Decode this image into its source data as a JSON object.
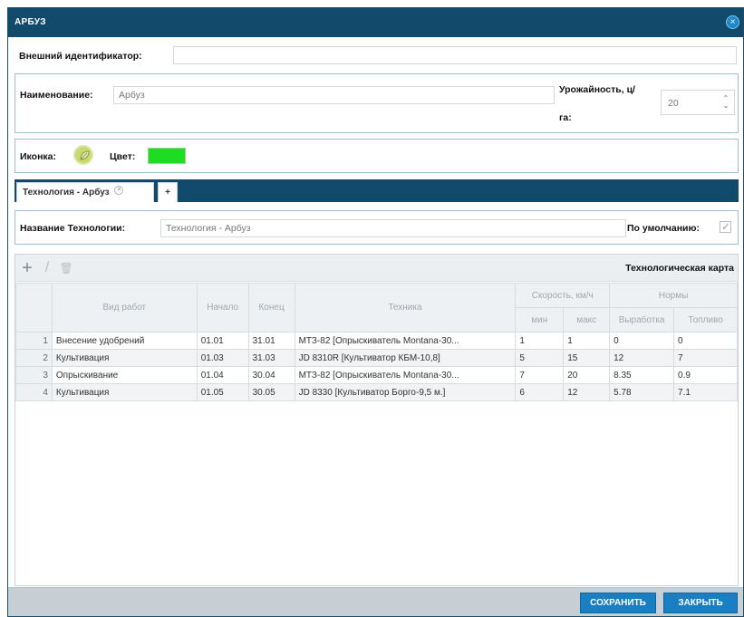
{
  "window": {
    "title": "АРБУЗ",
    "close_icon": "close-circle-icon"
  },
  "external_id": {
    "label": "Внешний идентификатор:",
    "value": ""
  },
  "name": {
    "label": "Наименование:",
    "value": "Арбуз"
  },
  "yield": {
    "label_line1": "Урожайность, ц/",
    "label_line2": "га:",
    "value": "20",
    "up_glyph": "⌃",
    "down_glyph": "⌄"
  },
  "appearance": {
    "icon_label": "Иконка:",
    "icon_name": "leaf-icon",
    "color_label": "Цвет:",
    "color_value": "#1edc22"
  },
  "tabs": [
    {
      "label": "Технология - Арбуз",
      "close_glyph": "×"
    }
  ],
  "add_tab": {
    "label": "+"
  },
  "technology": {
    "label": "Название Технологии:",
    "value": "Технология - Арбуз",
    "default_label": "По умолчанию:",
    "default_checked": true,
    "check_glyph": "✓"
  },
  "grid": {
    "title": "Технологическая карта",
    "toolbar": {
      "add": "+",
      "edit": "/",
      "delete": "🗑"
    },
    "headers": {
      "work_type": "Вид работ",
      "start": "Начало",
      "end": "Конец",
      "equipment": "Техника",
      "speed_group": "Скорость, км/ч",
      "speed_min": "мин",
      "speed_max": "макс",
      "norms_group": "Нормы",
      "output": "Выработка",
      "fuel": "Топливо"
    },
    "rows": [
      {
        "n": "1",
        "work": "Внесение удобрений",
        "start": "01.01",
        "end": "31.01",
        "equipment": "МТЗ-82 [Опрыскиватель Montana-30...",
        "min": "1",
        "max": "1",
        "output": "0",
        "fuel": "0"
      },
      {
        "n": "2",
        "work": "Культивация",
        "start": "01.03",
        "end": "31.03",
        "equipment": "JD 8310R [Культиватор КБМ-10,8]",
        "min": "5",
        "max": "15",
        "output": "12",
        "fuel": "7"
      },
      {
        "n": "3",
        "work": "Опрыскивание",
        "start": "01.04",
        "end": "30.04",
        "equipment": "МТЗ-82 [Опрыскиватель Montana-30...",
        "min": "7",
        "max": "20",
        "output": "8.35",
        "fuel": "0.9"
      },
      {
        "n": "4",
        "work": "Культивация",
        "start": "01.05",
        "end": "30.05",
        "equipment": "JD 8330 [Культиватор Борго-9,5 м.]",
        "min": "6",
        "max": "12",
        "output": "5.78",
        "fuel": "7.1"
      }
    ]
  },
  "footer": {
    "save_label": "СОХРАНИТЬ",
    "close_label": "ЗАКРЫТЬ"
  }
}
